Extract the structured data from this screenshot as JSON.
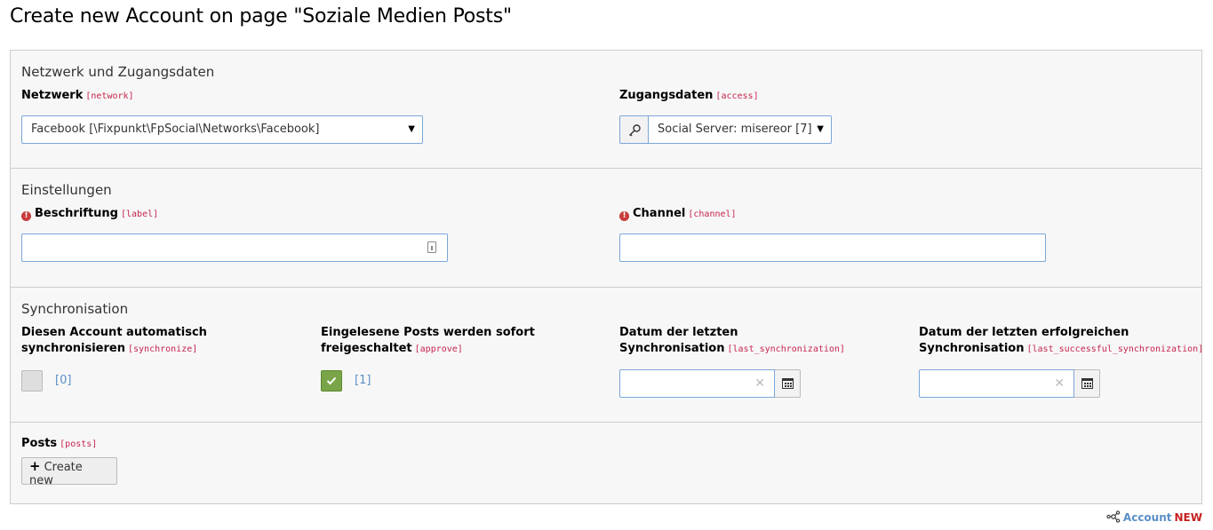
{
  "page": {
    "title": "Create new Account on page \"Soziale Medien Posts\""
  },
  "sections": {
    "network": {
      "legend": "Netzwerk und Zugangsdaten",
      "network_label": "Netzwerk",
      "network_field": "[network]",
      "network_value": "Facebook [\\Fixpunkt\\FpSocial\\Networks\\Facebook]",
      "access_label": "Zugangsdaten",
      "access_field": "[access]",
      "access_value": "Social Server: misereor [7]"
    },
    "settings": {
      "legend": "Einstellungen",
      "label_label": "Beschriftung",
      "label_field": "[label]",
      "label_value": "",
      "channel_label": "Channel",
      "channel_field": "[channel]",
      "channel_value": ""
    },
    "sync": {
      "legend": "Synchronisation",
      "synchronize_label_1": "Diesen Account automatisch",
      "synchronize_label_2": "synchronisieren",
      "synchronize_field": "[synchronize]",
      "synchronize_value": "[0]",
      "synchronize_checked": false,
      "approve_label_1": "Eingelesene Posts werden sofort",
      "approve_label_2": "freigeschaltet",
      "approve_field": "[approve]",
      "approve_value": "[1]",
      "approve_checked": true,
      "last_sync_label_1": "Datum der letzten",
      "last_sync_label_2": "Synchronisation",
      "last_sync_field": "[last_synchronization]",
      "last_sync_value": "",
      "last_success_label_1": "Datum der letzten erfolgreichen",
      "last_success_label_2": "Synchronisation",
      "last_success_field": "[last_successful_synchronization]",
      "last_success_value": ""
    },
    "posts": {
      "label": "Posts",
      "field": "[posts]",
      "create_button": "Create new"
    }
  },
  "footer": {
    "record_type": "Account",
    "record_status": "NEW"
  },
  "icons": {
    "access_addon": "key-icon",
    "required": "exclamation-icon",
    "date_clear": "clear-icon",
    "date_picker": "calendar-icon",
    "create": "plus-icon",
    "record": "record-icon"
  },
  "colors": {
    "field_name": "#c7254e",
    "checkbox_checked": "#79a548",
    "required_icon": "#c83c3c",
    "record_type": "#5a8fc7",
    "record_status": "#c81f1f"
  }
}
